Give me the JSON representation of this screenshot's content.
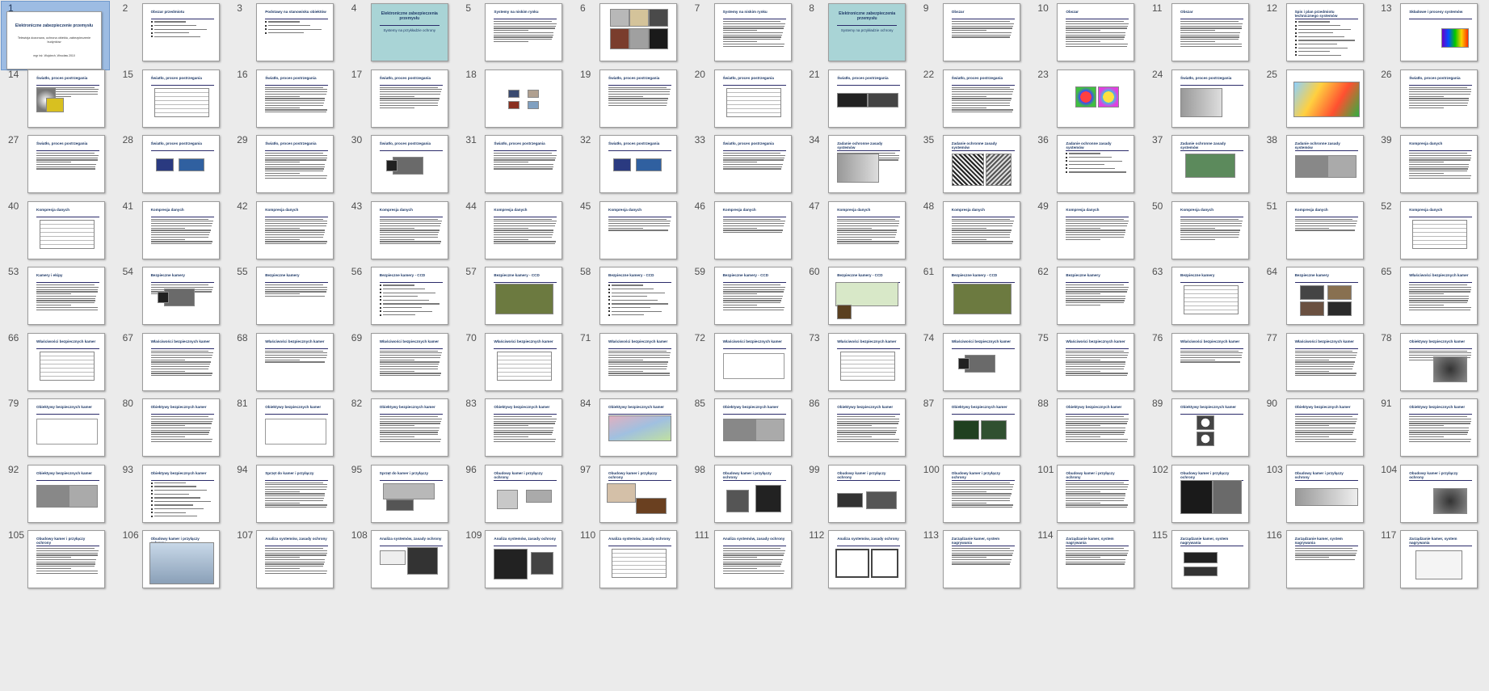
{
  "app": "PowerPoint - Slide Sorter",
  "selected_slide": 1,
  "title_slide": {
    "line1": "Elektroniczne zabezpieczenie przemysłu",
    "line2": "Telewizja dozorowa, ochrona obiektu, zabezpieczenie budynków",
    "line3": "mgr inż. Wojciech, Wrocław 2010"
  },
  "titles": {
    "a": "Obszar przedmiotu",
    "b": "Podstawy na stanowisku obiektów",
    "c": "Elektroniczne zabezpieczenia przemysłu",
    "c_sub": "Systemy na przykładzie ochrony",
    "d": "Systemy na niskim rynku",
    "e": "Obszar",
    "f": "Spis i plan przedmiotu technicznego systemów",
    "g": "Składowe i procesy systemów",
    "h": "Światło, proces postrzegania",
    "i": "Zadanie ochronne zasady systemów",
    "j": "Kompresja danych",
    "k": "Kamery i ekipy",
    "l": "Bezpieczne kamery",
    "m": "Bezpieczne kamery - CCD",
    "n": "Właściwości bezpiecznych kamer",
    "o": "Obiektywy bezpiecznych kamer",
    "p": "Sprzęt do kamer i przyłączy",
    "q": "Obudowy kamer i przyłączy ochrony",
    "r": "Analiza systemów, zasady ochrony",
    "s": "Zarządzanie kamer, system nagrywania"
  },
  "slides": [
    {
      "n": 1,
      "kind": "title"
    },
    {
      "n": 2,
      "kind": "bullets",
      "t": "a",
      "bl": 5
    },
    {
      "n": 3,
      "kind": "bullets",
      "t": "b",
      "bl": 4
    },
    {
      "n": 4,
      "kind": "section",
      "t": "c"
    },
    {
      "n": 5,
      "kind": "text",
      "t": "d",
      "ln": 10
    },
    {
      "n": 6,
      "kind": "image",
      "t": "",
      "img": "photos"
    },
    {
      "n": 7,
      "kind": "text",
      "t": "d",
      "ln": 12
    },
    {
      "n": 8,
      "kind": "section",
      "t": "c"
    },
    {
      "n": 9,
      "kind": "text",
      "t": "e",
      "ln": 8
    },
    {
      "n": 10,
      "kind": "text",
      "t": "e",
      "ln": 12
    },
    {
      "n": 11,
      "kind": "text",
      "t": "e",
      "ln": 12
    },
    {
      "n": 12,
      "kind": "bullets",
      "t": "f",
      "bl": 10
    },
    {
      "n": 13,
      "kind": "image",
      "t": "g",
      "img": "spectrum"
    },
    {
      "n": 14,
      "kind": "textimg",
      "t": "h",
      "img": "yellow"
    },
    {
      "n": 15,
      "kind": "table",
      "t": "h"
    },
    {
      "n": 16,
      "kind": "text",
      "t": "h",
      "ln": 12
    },
    {
      "n": 17,
      "kind": "text",
      "t": "h",
      "ln": 10
    },
    {
      "n": 18,
      "kind": "image",
      "t": "",
      "img": "small4"
    },
    {
      "n": 19,
      "kind": "text",
      "t": "h",
      "ln": 9
    },
    {
      "n": 20,
      "kind": "table",
      "t": "h"
    },
    {
      "n": 21,
      "kind": "image",
      "t": "h",
      "img": "dark"
    },
    {
      "n": 22,
      "kind": "text",
      "t": "h",
      "ln": 12
    },
    {
      "n": 23,
      "kind": "image",
      "t": "",
      "img": "rgb"
    },
    {
      "n": 24,
      "kind": "image",
      "t": "h",
      "img": "gray"
    },
    {
      "n": 25,
      "kind": "image",
      "t": "",
      "img": "map"
    },
    {
      "n": 26,
      "kind": "text",
      "t": "h",
      "ln": 10
    },
    {
      "n": 27,
      "kind": "text",
      "t": "h",
      "ln": 8
    },
    {
      "n": 28,
      "kind": "image",
      "t": "h",
      "img": "cable"
    },
    {
      "n": 29,
      "kind": "text",
      "t": "h",
      "ln": 12
    },
    {
      "n": 30,
      "kind": "image",
      "t": "h",
      "img": "camera"
    },
    {
      "n": 31,
      "kind": "text",
      "t": "h",
      "ln": 8
    },
    {
      "n": 32,
      "kind": "image",
      "t": "h",
      "img": "cable"
    },
    {
      "n": 33,
      "kind": "text",
      "t": "h",
      "ln": 8
    },
    {
      "n": 34,
      "kind": "textimg",
      "t": "i",
      "img": "gray"
    },
    {
      "n": 35,
      "kind": "image",
      "t": "i",
      "img": "noise"
    },
    {
      "n": 36,
      "kind": "bullets",
      "t": "i",
      "bl": 6
    },
    {
      "n": 37,
      "kind": "image",
      "t": "i",
      "img": "green"
    },
    {
      "n": 38,
      "kind": "image",
      "t": "i",
      "img": "street"
    },
    {
      "n": 39,
      "kind": "text",
      "t": "j",
      "ln": 12
    },
    {
      "n": 40,
      "kind": "table",
      "t": "j"
    },
    {
      "n": 41,
      "kind": "text",
      "t": "j",
      "ln": 12
    },
    {
      "n": 42,
      "kind": "text",
      "t": "j",
      "ln": 12
    },
    {
      "n": 43,
      "kind": "text",
      "t": "j",
      "ln": 12
    },
    {
      "n": 44,
      "kind": "text",
      "t": "j",
      "ln": 12
    },
    {
      "n": 45,
      "kind": "text",
      "t": "j",
      "ln": 6
    },
    {
      "n": 46,
      "kind": "text",
      "t": "j",
      "ln": 7
    },
    {
      "n": 47,
      "kind": "text",
      "t": "j",
      "ln": 12
    },
    {
      "n": 48,
      "kind": "text",
      "t": "j",
      "ln": 12
    },
    {
      "n": 49,
      "kind": "text",
      "t": "j",
      "ln": 10
    },
    {
      "n": 50,
      "kind": "text",
      "t": "j",
      "ln": 10
    },
    {
      "n": 51,
      "kind": "text",
      "t": "j",
      "ln": 6
    },
    {
      "n": 52,
      "kind": "table",
      "t": "j"
    },
    {
      "n": 53,
      "kind": "text",
      "t": "k",
      "ln": 12
    },
    {
      "n": 54,
      "kind": "textimg",
      "t": "l",
      "img": "camera"
    },
    {
      "n": 55,
      "kind": "text",
      "t": "l",
      "ln": 6
    },
    {
      "n": 56,
      "kind": "bullets",
      "t": "m",
      "bl": 9
    },
    {
      "n": 57,
      "kind": "image",
      "t": "m",
      "img": "chip"
    },
    {
      "n": 58,
      "kind": "bullets",
      "t": "m",
      "bl": 9
    },
    {
      "n": 59,
      "kind": "text",
      "t": "m",
      "ln": 12
    },
    {
      "n": 60,
      "kind": "image",
      "t": "m",
      "img": "diagram"
    },
    {
      "n": 61,
      "kind": "image",
      "t": "m",
      "img": "chip"
    },
    {
      "n": 62,
      "kind": "text",
      "t": "l",
      "ln": 10
    },
    {
      "n": 63,
      "kind": "table",
      "t": "l"
    },
    {
      "n": 64,
      "kind": "image",
      "t": "l",
      "img": "tiles"
    },
    {
      "n": 65,
      "kind": "text",
      "t": "n",
      "ln": 12
    },
    {
      "n": 66,
      "kind": "table",
      "t": "n"
    },
    {
      "n": 67,
      "kind": "text",
      "t": "n",
      "ln": 12
    },
    {
      "n": 68,
      "kind": "text",
      "t": "n",
      "ln": 6
    },
    {
      "n": 69,
      "kind": "text",
      "t": "n",
      "ln": 12
    },
    {
      "n": 70,
      "kind": "table",
      "t": "n"
    },
    {
      "n": 71,
      "kind": "text",
      "t": "n",
      "ln": 12
    },
    {
      "n": 72,
      "kind": "image",
      "t": "n",
      "img": "graph"
    },
    {
      "n": 73,
      "kind": "table",
      "t": "n"
    },
    {
      "n": 74,
      "kind": "image",
      "t": "n",
      "img": "camera"
    },
    {
      "n": 75,
      "kind": "text",
      "t": "n",
      "ln": 12
    },
    {
      "n": 76,
      "kind": "text",
      "t": "n",
      "ln": 6
    },
    {
      "n": 77,
      "kind": "text",
      "t": "n",
      "ln": 12
    },
    {
      "n": 78,
      "kind": "textimg",
      "t": "o",
      "img": "lens"
    },
    {
      "n": 79,
      "kind": "image",
      "t": "o",
      "img": "graph"
    },
    {
      "n": 80,
      "kind": "text",
      "t": "o",
      "ln": 12
    },
    {
      "n": 81,
      "kind": "image",
      "t": "o",
      "img": "graph"
    },
    {
      "n": 82,
      "kind": "text",
      "t": "o",
      "ln": 12
    },
    {
      "n": 83,
      "kind": "text",
      "t": "o",
      "ln": 12
    },
    {
      "n": 84,
      "kind": "image",
      "t": "o",
      "img": "rays"
    },
    {
      "n": 85,
      "kind": "image",
      "t": "o",
      "img": "street"
    },
    {
      "n": 86,
      "kind": "text",
      "t": "o",
      "ln": 12
    },
    {
      "n": 87,
      "kind": "image",
      "t": "o",
      "img": "night"
    },
    {
      "n": 88,
      "kind": "text",
      "t": "o",
      "ln": 12
    },
    {
      "n": 89,
      "kind": "image",
      "t": "o",
      "img": "rings"
    },
    {
      "n": 90,
      "kind": "text",
      "t": "o",
      "ln": 12
    },
    {
      "n": 91,
      "kind": "text",
      "t": "o",
      "ln": 12
    },
    {
      "n": 92,
      "kind": "image",
      "t": "o",
      "img": "street"
    },
    {
      "n": 93,
      "kind": "bullets",
      "t": "o",
      "bl": 10
    },
    {
      "n": 94,
      "kind": "text",
      "t": "p",
      "ln": 12
    },
    {
      "n": 95,
      "kind": "image",
      "t": "p",
      "img": "housing"
    },
    {
      "n": 96,
      "kind": "image",
      "t": "q",
      "img": "mounts"
    },
    {
      "n": 97,
      "kind": "image",
      "t": "q",
      "img": "mounts2"
    },
    {
      "n": 98,
      "kind": "image",
      "t": "q",
      "img": "ptz"
    },
    {
      "n": 99,
      "kind": "image",
      "t": "q",
      "img": "keyboard"
    },
    {
      "n": 100,
      "kind": "text",
      "t": "q",
      "ln": 12
    },
    {
      "n": 101,
      "kind": "text",
      "t": "q",
      "ln": 12
    },
    {
      "n": 102,
      "kind": "image",
      "t": "q",
      "img": "nightcam"
    },
    {
      "n": 103,
      "kind": "image",
      "t": "q",
      "img": "beam"
    },
    {
      "n": 104,
      "kind": "image",
      "t": "q",
      "img": "lens"
    },
    {
      "n": 105,
      "kind": "text",
      "t": "q",
      "ln": 12
    },
    {
      "n": 106,
      "kind": "image",
      "t": "q",
      "img": "screen"
    },
    {
      "n": 107,
      "kind": "text",
      "t": "r",
      "ln": 12
    },
    {
      "n": 108,
      "kind": "image",
      "t": "r",
      "img": "monitor"
    },
    {
      "n": 109,
      "kind": "image",
      "t": "r",
      "img": "monitors"
    },
    {
      "n": 110,
      "kind": "table",
      "t": "r"
    },
    {
      "n": 111,
      "kind": "text",
      "t": "r",
      "ln": 12
    },
    {
      "n": 112,
      "kind": "image",
      "t": "r",
      "img": "brackets"
    },
    {
      "n": 113,
      "kind": "text",
      "t": "s",
      "ln": 8
    },
    {
      "n": 114,
      "kind": "text",
      "t": "s",
      "ln": 8
    },
    {
      "n": 115,
      "kind": "image",
      "t": "s",
      "img": "dvr"
    },
    {
      "n": 116,
      "kind": "text",
      "t": "s",
      "ln": 6
    },
    {
      "n": 117,
      "kind": "image",
      "t": "s",
      "img": "net"
    }
  ]
}
